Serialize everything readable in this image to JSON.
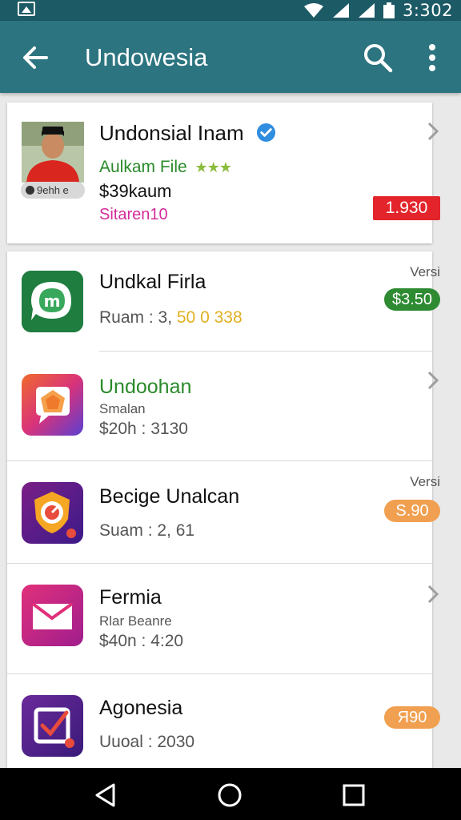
{
  "status_bar": {
    "time": "3:302",
    "icons": [
      "image-icon",
      "wifi-icon",
      "signal-icon",
      "signal-icon",
      "battery-icon"
    ]
  },
  "app_bar": {
    "title": "Undowesia",
    "icons": [
      "back-arrow-icon",
      "search-icon",
      "more-vert-icon"
    ]
  },
  "profile_card": {
    "name": "Undonsial Inam",
    "subtitle": "Aulkam File",
    "stars": "★★★",
    "price": "$39kaum",
    "status": "Sitaren10",
    "photo_tag": "9ehh e",
    "badge": "1.930",
    "colors": {
      "badge": "#e3242b",
      "status": "#d42c9a",
      "subtitle": "#2a8a2a"
    }
  },
  "apps": [
    {
      "name": "Undkal Firla",
      "meta_prefix": "Ruam : 3, ",
      "meta_highlight": "50 0 338",
      "version_label": "Versi",
      "price": "$3.50",
      "price_color": "#2e8b32",
      "icon": "chat-leaf-icon"
    },
    {
      "name": "Undoohan",
      "subtitle": "Smalan",
      "meta": "$20h : 3130",
      "icon": "chat-bubble-icon"
    },
    {
      "name": "Becige Unalcan",
      "meta": "Suam : 2, 61",
      "version_label": "Versi",
      "price": "S.90",
      "price_color": "#f0a050",
      "icon": "shield-badge-icon"
    },
    {
      "name": "Fermia",
      "subtitle": "Rlar Beanre",
      "meta": "$40n : 4:20",
      "icon": "mail-icon"
    },
    {
      "name": "Agonesia",
      "meta": "Uuoal : 2030",
      "price": "Я90",
      "price_color": "#f0a050",
      "icon": "check-box-icon"
    }
  ],
  "nav_bar": {
    "icons": [
      "back-triangle-icon",
      "home-circle-icon",
      "recents-square-icon"
    ]
  }
}
